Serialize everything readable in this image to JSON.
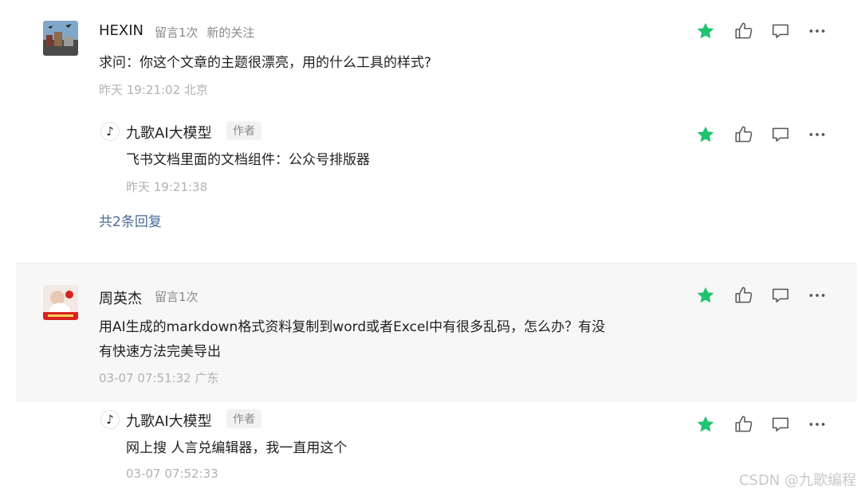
{
  "comments": [
    {
      "user": "HEXIN",
      "badges": [
        "留言1次",
        "新的关注"
      ],
      "content": "求问：你这个文章的主题很漂亮，用的什么工具的样式?",
      "time": "昨天 19:21:02 北京",
      "reply": {
        "user": "九歌AI大模型",
        "tag": "作者",
        "content": "飞书文档里面的文档组件：公众号排版器",
        "time": "昨天 19:21:38"
      },
      "more_replies": "共2条回复"
    },
    {
      "user": "周英杰",
      "badges": [
        "留言1次"
      ],
      "content_line1": "用AI生成的markdown格式资料复制到word或者Excel中有很多乱码，怎么办？有没",
      "content_line2": "有快速方法完美导出",
      "time": "03-07 07:51:32 广东",
      "reply": {
        "user": "九歌AI大模型",
        "tag": "作者",
        "content": "网上搜 人言兑编辑器，我一直用这个",
        "time": "03-07 07:52:33"
      }
    }
  ],
  "watermark": "CSDN @九歌编程",
  "icons": [
    "star-icon",
    "thumbs-up-icon",
    "comment-icon",
    "more-icon"
  ],
  "colors": {
    "star": "#1fc46e",
    "link": "#4a6b99"
  }
}
